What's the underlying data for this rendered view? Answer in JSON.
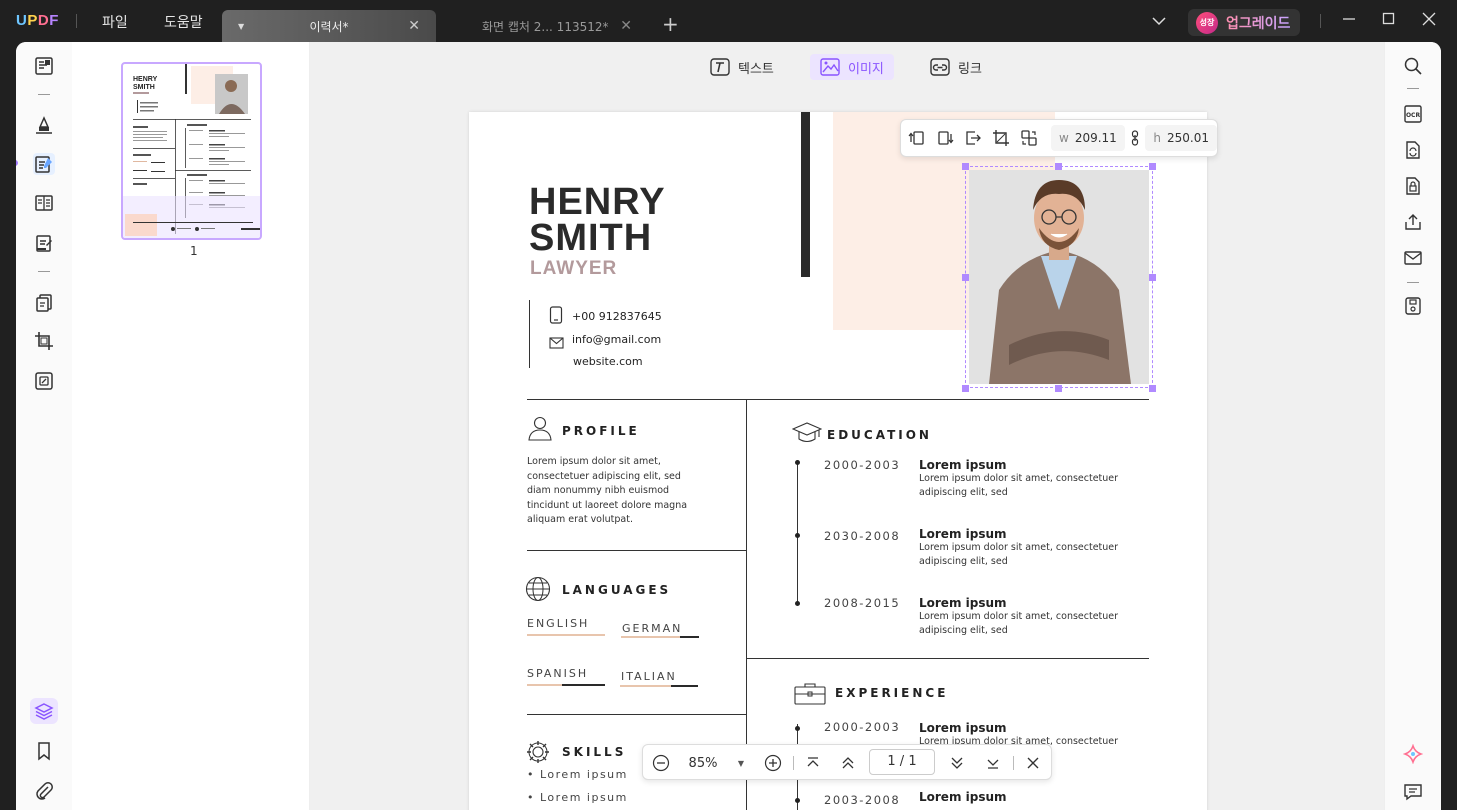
{
  "app": {
    "logo": "UPDF",
    "menu": [
      "파일",
      "도움말"
    ],
    "tabs": [
      {
        "label": "이력서*",
        "active": true
      },
      {
        "label": "화면 캡처 2... 113512*",
        "active": false
      }
    ],
    "upgrade_badge": "성장",
    "upgrade_label": "업그레이드"
  },
  "edit_toolbar": {
    "text_label": "텍스트",
    "image_label": "이미지",
    "link_label": "링크",
    "selected": "image"
  },
  "thumbnails": {
    "page_label": "1"
  },
  "image_toolbar": {
    "w_label": "w",
    "w_value": "209.11",
    "h_label": "h",
    "h_value": "250.01"
  },
  "resume": {
    "first_name": "HENRY",
    "last_name": "SMITH",
    "role": "LAWYER",
    "phone": "+00 912837645",
    "email": "info@gmail.com",
    "website": "website.com",
    "profile": {
      "title": "PROFILE",
      "text": [
        "Lorem ipsum dolor sit amet,",
        "consectetuer adipiscing elit, sed",
        "diam nonummy nibh euismod",
        "tincidunt ut laoreet dolore magna",
        "aliquam erat volutpat."
      ]
    },
    "languages": {
      "title": "LANGUAGES",
      "items": [
        {
          "name": "ENGLISH",
          "level": 1.0
        },
        {
          "name": "GERMAN",
          "level": 0.75
        },
        {
          "name": "SPANISH",
          "level": 0.45
        },
        {
          "name": "ITALIAN",
          "level": 0.65
        }
      ]
    },
    "skills": {
      "title": "SKILLS",
      "items": [
        "• Lorem ipsum",
        "• Lorem ipsum"
      ]
    },
    "education": {
      "title": "EDUCATION",
      "items": [
        {
          "years": "2000-2003",
          "head": "Lorem ipsum",
          "l1": "Lorem ipsum dolor sit amet, consectetuer",
          "l2": "adipiscing elit, sed"
        },
        {
          "years": "2030-2008",
          "head": "Lorem ipsum",
          "l1": "Lorem ipsum dolor sit amet, consectetuer",
          "l2": "adipiscing elit, sed"
        },
        {
          "years": "2008-2015",
          "head": "Lorem ipsum",
          "l1": "Lorem ipsum dolor sit amet, consectetuer",
          "l2": "adipiscing elit, sed"
        }
      ]
    },
    "experience": {
      "title": "EXPERIENCE",
      "items": [
        {
          "years": "2000-2003",
          "head": "Lorem ipsum",
          "l1": "Lorem ipsum dolor sit amet, consectetuer"
        },
        {
          "years": "2003-2008",
          "head": "Lorem ipsum"
        }
      ]
    }
  },
  "zoom_bar": {
    "zoom": "85%",
    "page_current": "1",
    "page_sep": "/",
    "page_total": "1"
  },
  "colors": {
    "accent": "#a37cff",
    "peach": "#fdeee6",
    "dark": "#2a2a2a"
  }
}
